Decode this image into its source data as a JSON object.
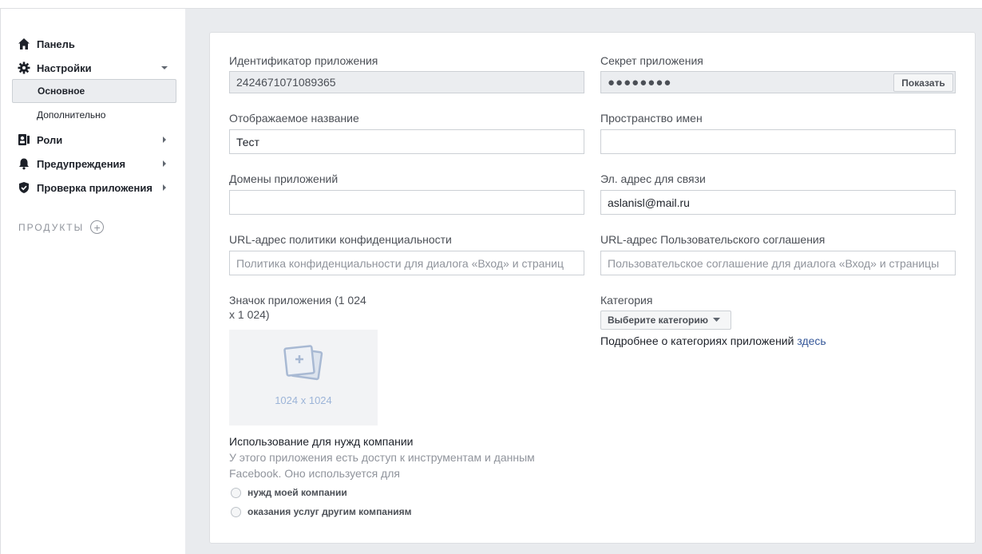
{
  "sidebar": {
    "items": [
      {
        "label": "Панель",
        "icon": "home-icon"
      },
      {
        "label": "Настройки",
        "icon": "gear-icon"
      },
      {
        "label": "Роли",
        "icon": "roles-icon"
      },
      {
        "label": "Предупреждения",
        "icon": "bell-icon"
      },
      {
        "label": "Проверка приложения",
        "icon": "shield-icon"
      }
    ],
    "settings_sub": [
      {
        "label": "Основное",
        "active": true
      },
      {
        "label": "Дополнительно",
        "active": false
      }
    ],
    "products_label": "ПРОДУКТЫ"
  },
  "form": {
    "app_id": {
      "label": "Идентификатор приложения",
      "value": "2424671071089365"
    },
    "app_secret": {
      "label": "Секрет приложения",
      "value": "●●●●●●●●",
      "show_button": "Показать"
    },
    "display_name": {
      "label": "Отображаемое название",
      "value": "Тест"
    },
    "namespace": {
      "label": "Пространство имен",
      "value": ""
    },
    "app_domains": {
      "label": "Домены приложений",
      "value": ""
    },
    "contact_email": {
      "label": "Эл. адрес для связи",
      "value": "aslanisl@mail.ru"
    },
    "privacy_url": {
      "label": "URL-адрес политики конфиденциальности",
      "placeholder": "Политика конфиденциальности для диалога «Вход» и страниц"
    },
    "tos_url": {
      "label": "URL-адрес Пользовательского соглашения",
      "placeholder": "Пользовательское соглашение для диалога «Вход» и страницы"
    },
    "app_icon": {
      "label_line1": "Значок приложения (1 024",
      "label_line2": "x 1 024)",
      "size_text": "1024 x 1024"
    },
    "category": {
      "label": "Категория",
      "dropdown": "Выберите категорию",
      "info_text": "Подробнее о категориях приложений ",
      "info_link": "здесь"
    },
    "business_use": {
      "label": "Использование для нужд компании",
      "desc_line1": "У этого приложения есть доступ к инструментам и данным",
      "desc_line2": "Facebook. Оно используется для",
      "options": [
        "нужд моей компании",
        "оказания услуг другим компаниям"
      ]
    }
  },
  "colors": {
    "accent_link": "#365899",
    "page_bg": "#e9ebee",
    "readonly_bg": "#ebedf0"
  }
}
